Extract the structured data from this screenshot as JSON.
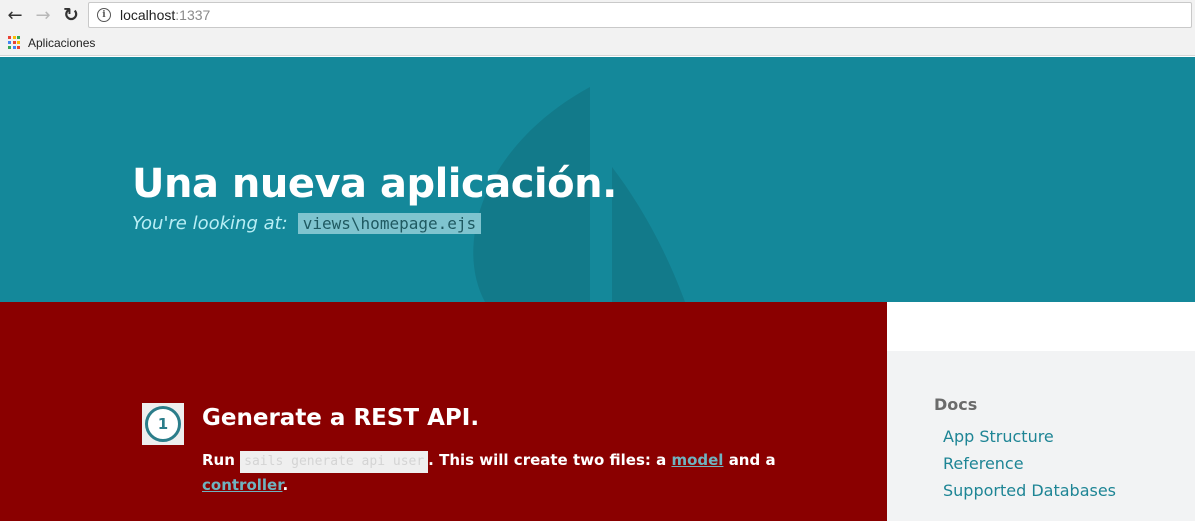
{
  "browser": {
    "url_host": "localhost",
    "url_port": ":1337",
    "bookmarks_label": "Aplicaciones"
  },
  "hero": {
    "title": "Una nueva aplicación.",
    "subtitle_label": "You're looking at:",
    "subtitle_code": "views\\homepage.ejs"
  },
  "step": {
    "number": "1",
    "title": "Generate a REST API.",
    "body_prefix": "Run",
    "command": "sails generate api user",
    "body_mid": ". This will create two files: a",
    "link_model": "model",
    "body_and": "and a",
    "link_controller": "controller",
    "body_end": "."
  },
  "docs": {
    "title": "Docs",
    "links": [
      "App Structure",
      "Reference",
      "Supported Databases"
    ]
  },
  "colors": {
    "hero_bg": "#14889a",
    "main_bg": "#8a0000",
    "docs_bg": "#f2f3f4",
    "link": "#1e8595"
  },
  "icons": {
    "back": "arrow-left-icon",
    "forward": "arrow-right-icon",
    "reload": "reload-icon",
    "site_info": "info-icon",
    "apps": "apps-grid-icon"
  }
}
